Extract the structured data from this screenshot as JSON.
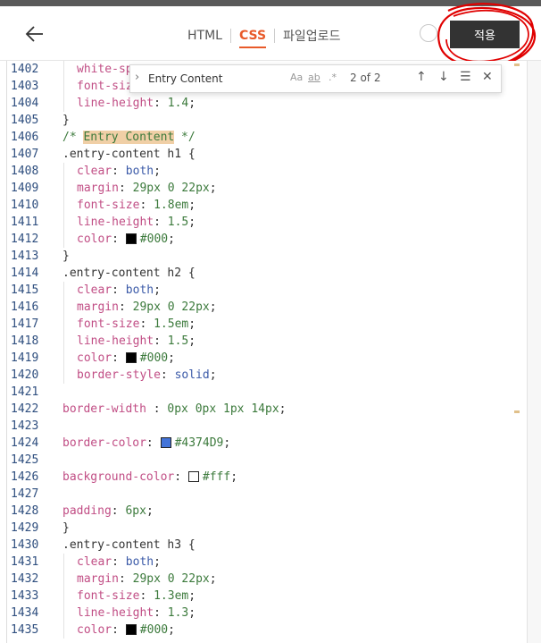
{
  "header": {
    "tabs": [
      {
        "label": "HTML",
        "active": false
      },
      {
        "label": "CSS",
        "active": true
      },
      {
        "label": "파일업로드",
        "active": false
      }
    ],
    "apply_label": "적용"
  },
  "find": {
    "query": "Entry Content",
    "option_case": "Aa",
    "option_word": "ab",
    "option_regex": ".*",
    "count": "2 of 2"
  },
  "lines": [
    {
      "n": "1402",
      "code": "  white-sp"
    },
    {
      "n": "1403",
      "code": "  font-siz"
    },
    {
      "n": "1404",
      "code": "  line-height: 1.4;"
    },
    {
      "n": "1405",
      "code": "}"
    },
    {
      "n": "1406",
      "code": "/* Entry Content */"
    },
    {
      "n": "1407",
      "code": ".entry-content h1 {"
    },
    {
      "n": "1408",
      "code": "  clear: both;"
    },
    {
      "n": "1409",
      "code": "  margin: 29px 0 22px;"
    },
    {
      "n": "1410",
      "code": "  font-size: 1.8em;"
    },
    {
      "n": "1411",
      "code": "  line-height: 1.5;"
    },
    {
      "n": "1412",
      "code": "  color: #000;"
    },
    {
      "n": "1413",
      "code": "}"
    },
    {
      "n": "1414",
      "code": ".entry-content h2 {"
    },
    {
      "n": "1415",
      "code": "  clear: both;"
    },
    {
      "n": "1416",
      "code": "  margin: 29px 0 22px;"
    },
    {
      "n": "1417",
      "code": "  font-size: 1.5em;"
    },
    {
      "n": "1418",
      "code": "  line-height: 1.5;"
    },
    {
      "n": "1419",
      "code": "  color: #000;"
    },
    {
      "n": "1420",
      "code": "  border-style: solid;"
    },
    {
      "n": "1421",
      "code": ""
    },
    {
      "n": "1422",
      "code": "border-width : 0px 0px 1px 14px;"
    },
    {
      "n": "1423",
      "code": ""
    },
    {
      "n": "1424",
      "code": "border-color: #4374D9;"
    },
    {
      "n": "1425",
      "code": ""
    },
    {
      "n": "1426",
      "code": "background-color: #fff;"
    },
    {
      "n": "1427",
      "code": ""
    },
    {
      "n": "1428",
      "code": "padding: 6px;"
    },
    {
      "n": "1429",
      "code": "}"
    },
    {
      "n": "1430",
      "code": ".entry-content h3 {"
    },
    {
      "n": "1431",
      "code": "  clear: both;"
    },
    {
      "n": "1432",
      "code": "  margin: 29px 0 22px;"
    },
    {
      "n": "1433",
      "code": "  font-size: 1.3em;"
    },
    {
      "n": "1434",
      "code": "  line-height: 1.3;"
    },
    {
      "n": "1435",
      "code": "  color: #000;"
    }
  ],
  "colors": {
    "accent": "#e85a2a",
    "apply_bg": "#333333",
    "annotation": "#e00000",
    "swatch_black": "#000000",
    "swatch_blue": "#4374D9",
    "swatch_white": "#ffffff"
  }
}
